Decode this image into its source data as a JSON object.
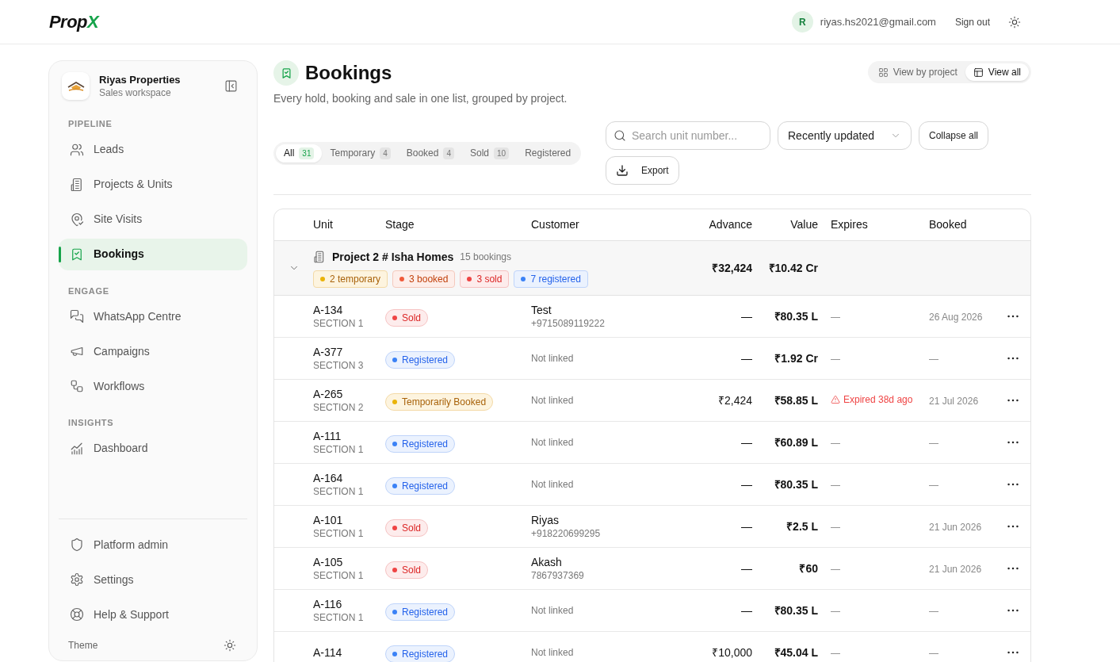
{
  "header": {
    "logo": {
      "main": "Prop",
      "accent": "X"
    },
    "user": {
      "avatar": "R",
      "email": "riyas.hs2021@gmail.com"
    },
    "sign_out": "Sign out"
  },
  "sidebar": {
    "workspace": {
      "name": "Riyas Properties",
      "subtitle": "Sales workspace"
    },
    "sections": [
      {
        "heading": "PIPELINE",
        "items": [
          {
            "label": "Leads",
            "selected": false
          },
          {
            "label": "Projects & Units",
            "selected": false
          },
          {
            "label": "Site Visits",
            "selected": false
          },
          {
            "label": "Bookings",
            "selected": true
          }
        ]
      },
      {
        "heading": "ENGAGE",
        "items": [
          {
            "label": "WhatsApp Centre",
            "selected": false
          },
          {
            "label": "Campaigns",
            "selected": false
          },
          {
            "label": "Workflows",
            "selected": false
          }
        ]
      },
      {
        "heading": "INSIGHTS",
        "items": [
          {
            "label": "Dashboard",
            "selected": false
          }
        ]
      }
    ],
    "footer_items": [
      {
        "label": "Platform admin",
        "selected": false
      },
      {
        "label": "Settings",
        "selected": false
      },
      {
        "label": "Help & Support",
        "selected": false
      }
    ],
    "theme_label": "Theme"
  },
  "page": {
    "title": "Bookings",
    "subtitle": "Every hold, booking and sale in one list, grouped by project.",
    "view_toggle": [
      {
        "label": "View by project",
        "selected": false
      },
      {
        "label": "View all",
        "selected": true
      }
    ],
    "filter_tabs": [
      {
        "label": "All",
        "count": "31",
        "selected": true
      },
      {
        "label": "Temporary",
        "count": "4",
        "selected": false
      },
      {
        "label": "Booked",
        "count": "4",
        "selected": false
      },
      {
        "label": "Sold",
        "count": "10",
        "selected": false
      },
      {
        "label": "Registered",
        "selected": false
      }
    ],
    "search": {
      "placeholder": "Search unit number..."
    },
    "sort": {
      "value": "Recently updated"
    },
    "collapse_button": "Collapse all",
    "export_button": "Export"
  },
  "table": {
    "columns": [
      "Unit",
      "Stage",
      "Customer",
      "Advance",
      "Value",
      "Expires",
      "Booked"
    ],
    "group": {
      "name": "Project 2 # Isha Homes",
      "count": "15 bookings",
      "expanded": true,
      "advance": "₹32,424",
      "value": "₹10.42 Cr",
      "tags": [
        {
          "label": "2 temporary",
          "kind": "temporary"
        },
        {
          "label": "3 booked",
          "kind": "booked"
        },
        {
          "label": "3 sold",
          "kind": "sold"
        },
        {
          "label": "7 registered",
          "kind": "registered"
        }
      ]
    },
    "rows": [
      {
        "unit": "A-134",
        "section": "SECTION 1",
        "stage": {
          "label": "Sold",
          "kind": "sold"
        },
        "customer": {
          "name": "Test",
          "phone": "+9715089119222"
        },
        "advance": "—",
        "value": "₹80.35 L",
        "expires": {
          "text": "—",
          "expired": false
        },
        "booked": "26 Aug 2026"
      },
      {
        "unit": "A-377",
        "section": "SECTION 3",
        "stage": {
          "label": "Registered",
          "kind": "registered"
        },
        "customer": {
          "note": "Not linked"
        },
        "advance": "—",
        "value": "₹1.92 Cr",
        "expires": {
          "text": "—",
          "expired": false
        },
        "booked": "—"
      },
      {
        "unit": "A-265",
        "section": "SECTION 2",
        "stage": {
          "label": "Temporarily Booked",
          "kind": "temporary"
        },
        "customer": {
          "note": "Not linked"
        },
        "advance": "₹2,424",
        "value": "₹58.85 L",
        "expires": {
          "text": "Expired 38d ago",
          "expired": true
        },
        "booked": "21 Jul 2026"
      },
      {
        "unit": "A-111",
        "section": "SECTION 1",
        "stage": {
          "label": "Registered",
          "kind": "registered"
        },
        "customer": {
          "note": "Not linked"
        },
        "advance": "—",
        "value": "₹60.89 L",
        "expires": {
          "text": "—",
          "expired": false
        },
        "booked": "—"
      },
      {
        "unit": "A-164",
        "section": "SECTION 1",
        "stage": {
          "label": "Registered",
          "kind": "registered"
        },
        "customer": {
          "note": "Not linked"
        },
        "advance": "—",
        "value": "₹80.35 L",
        "expires": {
          "text": "—",
          "expired": false
        },
        "booked": "—"
      },
      {
        "unit": "A-101",
        "section": "SECTION 1",
        "stage": {
          "label": "Sold",
          "kind": "sold"
        },
        "customer": {
          "name": "Riyas",
          "phone": "+918220699295"
        },
        "advance": "—",
        "value": "₹2.5 L",
        "expires": {
          "text": "—",
          "expired": false
        },
        "booked": "21 Jun 2026"
      },
      {
        "unit": "A-105",
        "section": "SECTION 1",
        "stage": {
          "label": "Sold",
          "kind": "sold"
        },
        "customer": {
          "name": "Akash",
          "phone": "7867937369"
        },
        "advance": "—",
        "value": "₹60",
        "expires": {
          "text": "—",
          "expired": false
        },
        "booked": "21 Jun 2026"
      },
      {
        "unit": "A-116",
        "section": "SECTION 1",
        "stage": {
          "label": "Registered",
          "kind": "registered"
        },
        "customer": {
          "note": "Not linked"
        },
        "advance": "—",
        "value": "₹80.35 L",
        "expires": {
          "text": "—",
          "expired": false
        },
        "booked": "—"
      },
      {
        "unit": "A-114",
        "stage": {
          "label": "Registered",
          "kind": "registered"
        },
        "customer": {
          "note": "Not linked"
        },
        "advance": "₹10,000",
        "value": "₹45.04 L",
        "expires": {
          "text": "—",
          "expired": false
        },
        "booked": "—"
      }
    ]
  }
}
